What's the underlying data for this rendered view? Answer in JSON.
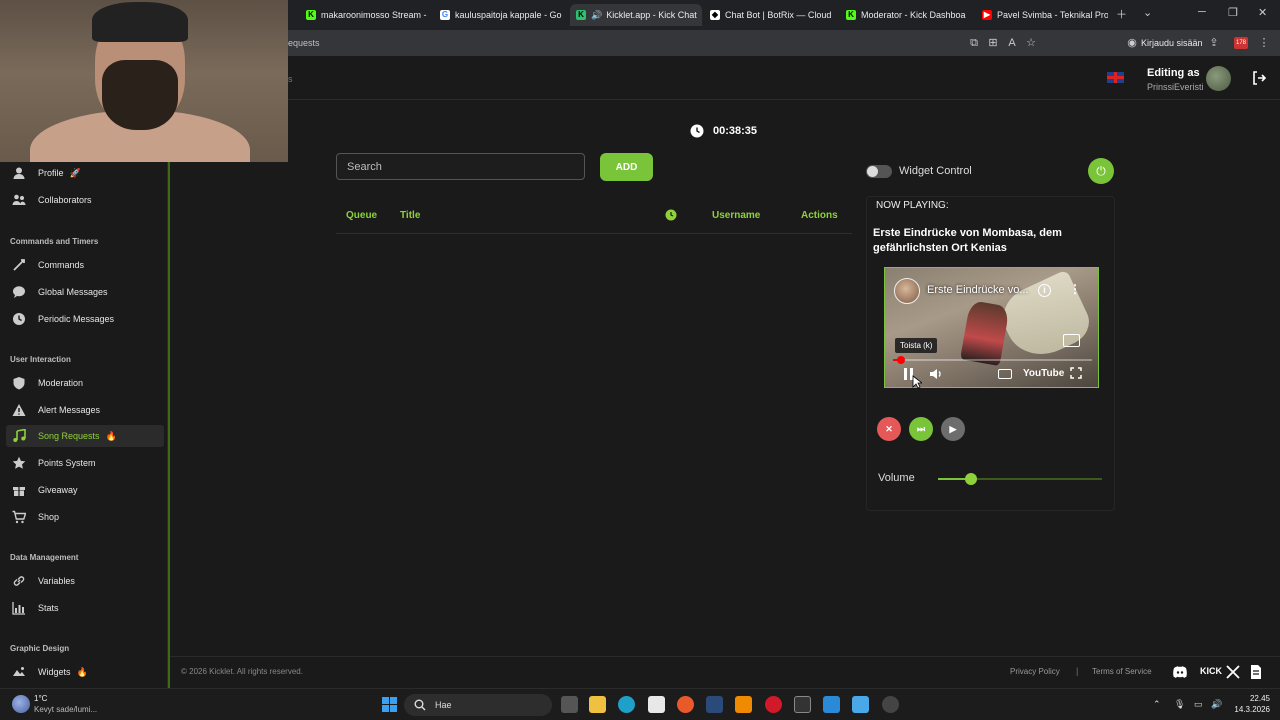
{
  "browser": {
    "tabs": [
      {
        "label": "makaroonimosso Stream -",
        "fav_color": "#53fc18",
        "fav_glyph": "K"
      },
      {
        "label": "kauluspaitoja kappale - Go",
        "fav_color": "#ffffff",
        "fav_glyph": "G"
      },
      {
        "label": "Kicklet.app - Kick Chat",
        "fav_color": "#2fbf71",
        "fav_glyph": "K"
      },
      {
        "label": "Chat Bot | BotRix — Cloud",
        "fav_color": "#ffffff",
        "fav_glyph": "◆"
      },
      {
        "label": "Moderator - Kick Dashboa",
        "fav_color": "#53fc18",
        "fav_glyph": "K"
      },
      {
        "label": "Pavel Svimba - Teknikal Pro",
        "fav_color": "#ff0000",
        "fav_glyph": "▶"
      }
    ],
    "address_text": "equests",
    "signin_label": "Kirjaudu sisään",
    "extension_badge": "178"
  },
  "header": {
    "left_fragment": "s",
    "editing_as_label": "Editing as",
    "editing_user": "PrinssiEveristi"
  },
  "sidebar": {
    "items_top": [
      {
        "label": "Profile",
        "icon": "user-icon",
        "badge": "🚀"
      },
      {
        "label": "Collaborators",
        "icon": "collaborators-icon",
        "badge": ""
      }
    ],
    "sections": [
      {
        "title": "Commands and Timers",
        "items": [
          {
            "label": "Commands",
            "icon": "commands-icon",
            "badge": ""
          },
          {
            "label": "Global Messages",
            "icon": "chat-bubble-icon",
            "badge": ""
          },
          {
            "label": "Periodic Messages",
            "icon": "clock-icon",
            "badge": ""
          }
        ]
      },
      {
        "title": "User Interaction",
        "items": [
          {
            "label": "Moderation",
            "icon": "shield-icon",
            "badge": ""
          },
          {
            "label": "Alert Messages",
            "icon": "alert-icon",
            "badge": ""
          },
          {
            "label": "Song Requests",
            "icon": "music-note-icon",
            "badge": "🔥",
            "active": true
          },
          {
            "label": "Points System",
            "icon": "star-icon",
            "badge": ""
          },
          {
            "label": "Giveaway",
            "icon": "gift-icon",
            "badge": ""
          },
          {
            "label": "Shop",
            "icon": "cart-icon",
            "badge": ""
          }
        ]
      },
      {
        "title": "Data Management",
        "items": [
          {
            "label": "Variables",
            "icon": "link-icon",
            "badge": ""
          },
          {
            "label": "Stats",
            "icon": "bar-chart-icon",
            "badge": ""
          }
        ]
      },
      {
        "title": "Graphic Design",
        "items": [
          {
            "label": "Widgets",
            "icon": "widget-icon",
            "badge": "🔥"
          }
        ]
      }
    ]
  },
  "main": {
    "timer": "00:38:35",
    "search_placeholder": "Search",
    "add_label": "ADD",
    "columns": {
      "queue": "Queue",
      "title": "Title",
      "username": "Username",
      "actions": "Actions"
    }
  },
  "widget": {
    "control_label": "Widget Control",
    "toggle_on": false,
    "now_playing_label": "NOW PLAYING:",
    "song_title": "Erste Eindrücke von Mombasa, dem gefährlichsten Ort Kenias",
    "video_title": "Erste Eindrücke vo...",
    "tooltip": "Toista (k)",
    "youtube_label": "YouTube",
    "progress": 0.04,
    "volume_label": "Volume",
    "volume": 0.2
  },
  "footer": {
    "copyright": "© 2026 Kicklet. All rights reserved.",
    "privacy": "Privacy Policy",
    "separator": "|",
    "terms": "Terms of Service",
    "kick_label": "KICK"
  },
  "taskbar": {
    "weather_temp": "1°C",
    "weather_desc": "Kevyt sade/lumi...",
    "search_label": "Hae",
    "time": "22.45",
    "date": "14.3.2026"
  },
  "colors": {
    "accent": "#7ac43a",
    "accent_text": "#8fd13b",
    "danger": "#e45858"
  }
}
